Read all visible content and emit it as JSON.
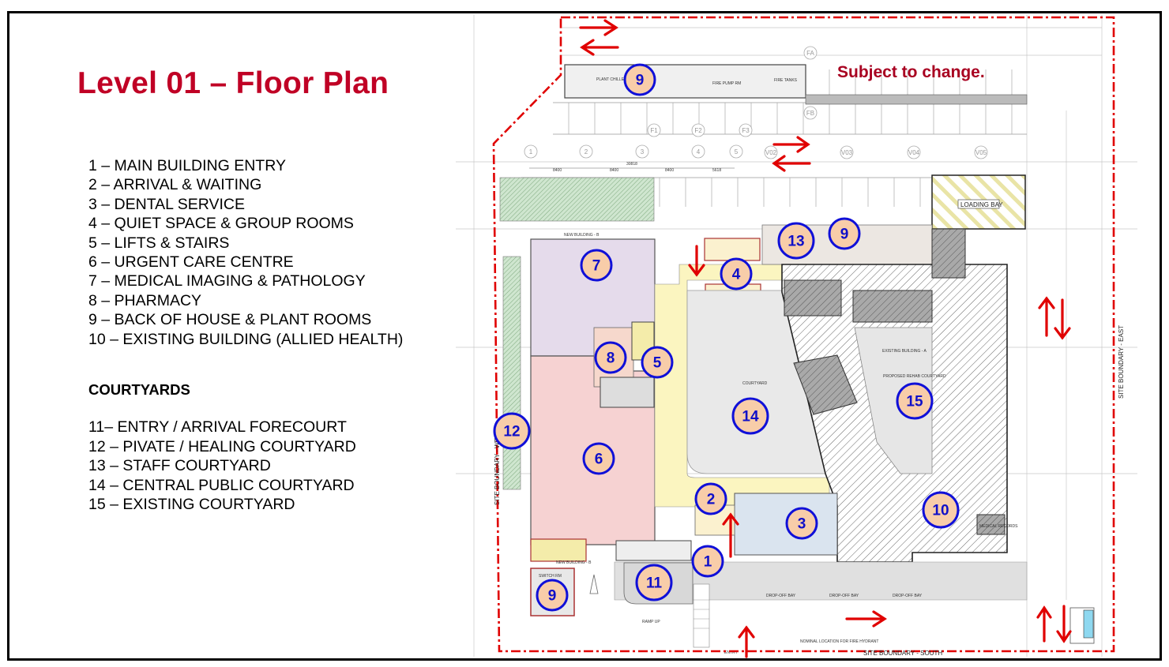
{
  "title": "Level 01 – Floor Plan",
  "legend": [
    "1 – MAIN BUILDING ENTRY",
    "2 – ARRIVAL & WAITING",
    "3 – DENTAL SERVICE",
    "4 – QUIET SPACE & GROUP ROOMS",
    "5 – LIFTS & STAIRS",
    "6 – URGENT CARE CENTRE",
    "7 – MEDICAL IMAGING & PATHOLOGY",
    "8 – PHARMACY",
    "9 – BACK OF HOUSE & PLANT ROOMS",
    "10 – EXISTING BUILDING (ALLIED HEALTH)"
  ],
  "courtyards": {
    "heading": "COURTYARDS",
    "items": [
      "11– ENTRY / ARRIVAL FORECOURT",
      "12 – PIVATE / HEALING COURTYARD",
      "13 – STAFF COURTYARD",
      "14 – CENTRAL PUBLIC COURTYARD",
      "15 – EXISTING COURTYARD"
    ]
  },
  "plan": {
    "notice": "Subject to change.",
    "markers": [
      "9",
      "13",
      "9",
      "7",
      "4",
      "8",
      "5",
      "15",
      "14",
      "12",
      "6",
      "2",
      "10",
      "3",
      "1",
      "11",
      "9"
    ],
    "labels": {
      "loading_bay": "LOADING BAY",
      "boundary_south": "SITE BOUNDARY - SOUTH",
      "boundary_west": "SITE BOUNDARY - WEST",
      "boundary_east": "SITE BOUNDARY - EAST",
      "courtyard": "COURTYARD",
      "existing_building": "EXISTING BUILDING - A",
      "rehab": "PROPOSED REHAB COURTYARD",
      "new_building_top": "NEW BUILDING - B",
      "new_building_bottom": "NEW BUILDING - B",
      "drop_off_1": "DROP-OFF BAY",
      "drop_off_2": "DROP-OFF BAY",
      "drop_off_3": "DROP-OFF BAY",
      "ramp_up": "RAMP UP",
      "switch_rm": "SWITCH RM",
      "plant_chiller": "PLANT CHILLER",
      "fire_pump": "FIRE PUMP RM",
      "fire_tanks": "FIRE TANKS",
      "medical_records": "MEDICAL RECORDS",
      "fire_hydrant": "NOMINAL LOCATION FOR FIRE HYDRANT",
      "entry": "ENTRY"
    },
    "grid_labels": [
      "1",
      "2",
      "3",
      "4",
      "5",
      "F1",
      "F2",
      "F3",
      "FA",
      "FB",
      "V02",
      "V03",
      "V04",
      "V05"
    ],
    "dimensions": [
      "8400",
      "8400",
      "8400",
      "5618",
      "30818"
    ],
    "colors": {
      "boundary": "#e00000",
      "marker_fill": "#f8cda9",
      "marker_stroke": "#1010d8",
      "imaging": "#e5dbeb",
      "urgent_care": "#f6d2d2",
      "circulation": "#fbf5c0",
      "dental": "#dae4ef",
      "courtyard": "#e9e9e9"
    }
  }
}
